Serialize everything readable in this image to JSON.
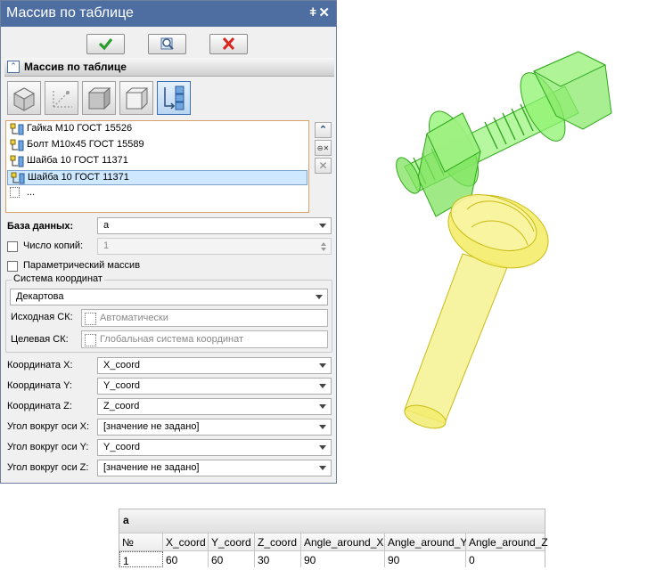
{
  "panel": {
    "title": "Массив по таблице",
    "pin_glyph": "ǂ",
    "close_glyph": "✕",
    "toolbar": {
      "ok_icon": "checkmark-icon",
      "preview_icon": "preview-icon",
      "cancel_icon": "cancel-x-icon"
    },
    "section_title": "Массив по таблице",
    "section_chevron": "⌃",
    "tools": [
      {
        "name": "solid-box-tool-icon",
        "active": false
      },
      {
        "name": "axis-path-tool-icon",
        "active": false
      },
      {
        "name": "box-tool-icon",
        "active": false
      },
      {
        "name": "box-outline-tool-icon",
        "active": false
      },
      {
        "name": "assembly-array-tool-icon",
        "active": true
      }
    ],
    "items": [
      {
        "label": "Гайка М10 ГОСТ 15526",
        "selected": false
      },
      {
        "label": "Болт М10х45 ГОСТ 15589",
        "selected": false
      },
      {
        "label": "Шайба 10 ГОСТ 11371",
        "selected": false
      },
      {
        "label": "Шайба 10 ГОСТ 11371",
        "selected": true
      },
      {
        "label": "...",
        "selected": false
      }
    ],
    "list_buttons": {
      "up": "⌃",
      "remove": "⊖✕",
      "delete": "✕"
    },
    "database_label": "База данных:",
    "database_value": "a",
    "copies_label": "Число копий:",
    "copies_value": "1",
    "parametric_label": "Параметрический массив",
    "cs_group_label": "Система координат",
    "cs_value": "Декартова",
    "source_cs_label": "Исходная СК:",
    "source_cs_placeholder": "Автоматически",
    "target_cs_label": "Целевая СК:",
    "target_cs_placeholder": "Глобальная система координат",
    "params": [
      {
        "label": "Координата X:",
        "value": "X_coord"
      },
      {
        "label": "Координата Y:",
        "value": "Y_coord"
      },
      {
        "label": "Координата Z:",
        "value": "Z_coord"
      },
      {
        "label": "Угол вокруг оси X:",
        "value": "[значение не задано]"
      },
      {
        "label": "Угол вокруг оси Y:",
        "value": "Y_coord"
      },
      {
        "label": "Угол вокруг оси Z:",
        "value": "[значение не задано]"
      }
    ]
  },
  "table": {
    "caption": "a",
    "headers": [
      "№",
      "X_coord",
      "Y_coord",
      "Z_coord",
      "Angle_around_X",
      "Angle_around_Y",
      "Angle_around_Z"
    ],
    "row": [
      "1",
      "60",
      "60",
      "30",
      "90",
      "90",
      "0"
    ]
  },
  "colors": {
    "titlebar": "#4e6ea1",
    "model_green": "#63e34a",
    "model_yellow": "#f1ee7a",
    "ok_green": "#2e9d2e",
    "cancel_red": "#d9251f"
  }
}
